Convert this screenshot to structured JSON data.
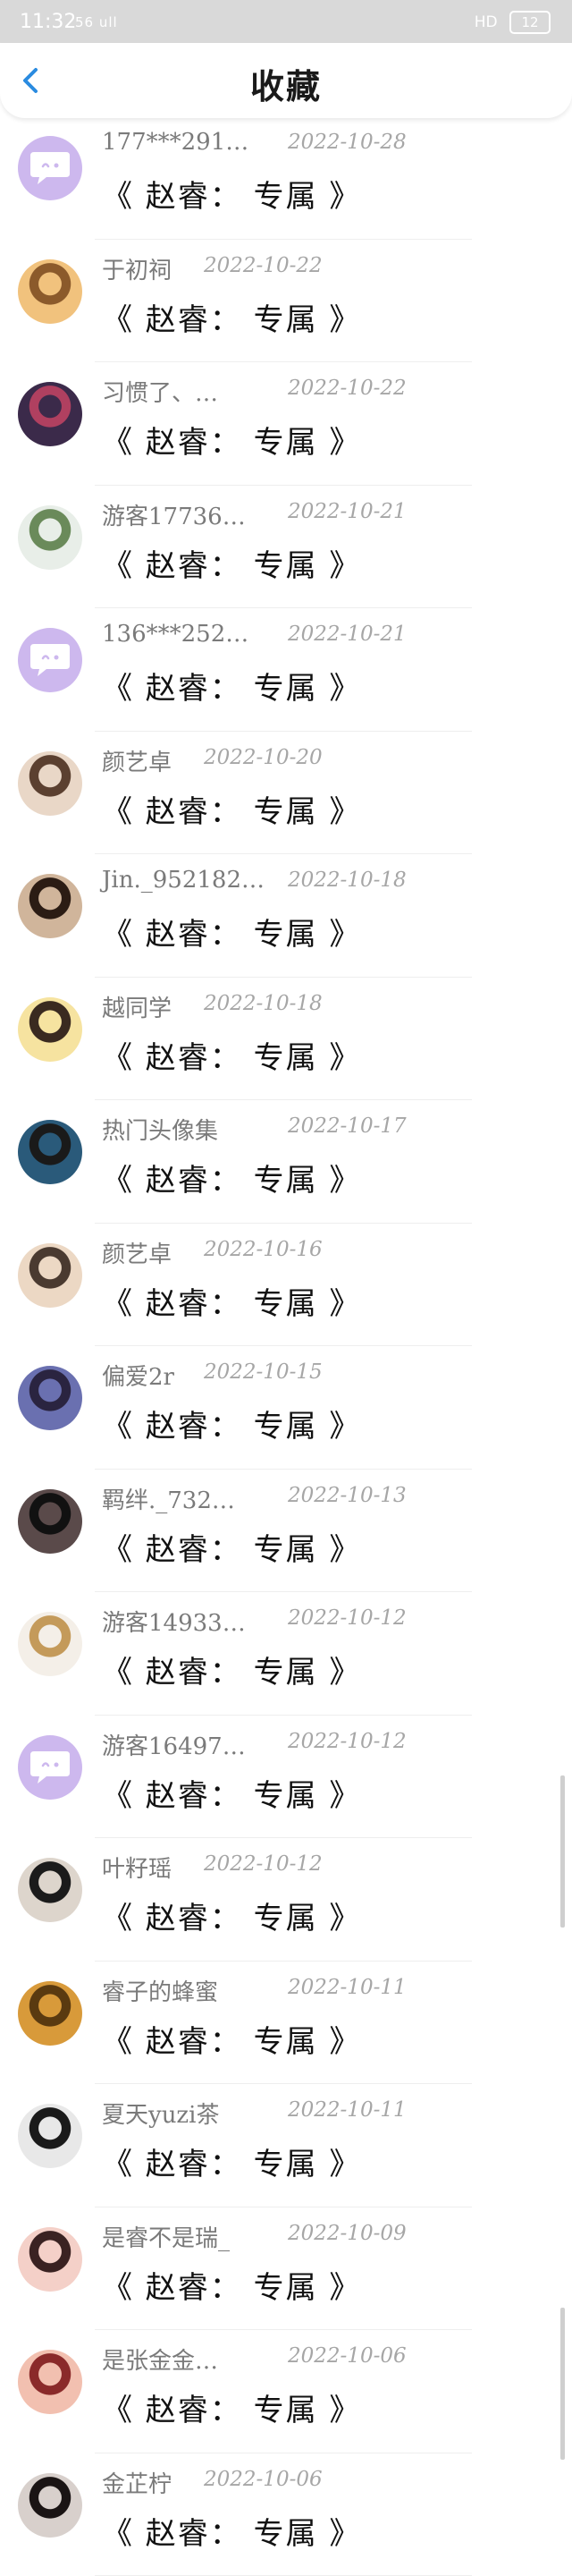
{
  "status": {
    "time": "11:32",
    "signal": "56 ull",
    "network": "HD",
    "battery": "12"
  },
  "header": {
    "title": "收藏"
  },
  "items": [
    {
      "name": "177***291…",
      "date": "2022-10-28",
      "subtitle": "《 赵睿： 专属 》",
      "avatar": "chat-avatar-icon"
    },
    {
      "name": "于初祠",
      "date": "2022-10-22",
      "subtitle": "《 赵睿： 专属 》",
      "avatar": "photo-avatar"
    },
    {
      "name": "习惯了、…",
      "date": "2022-10-22",
      "subtitle": "《 赵睿： 专属 》",
      "avatar": "photo-avatar"
    },
    {
      "name": "游客17736…",
      "date": "2022-10-21",
      "subtitle": "《 赵睿： 专属 》",
      "avatar": "photo-avatar"
    },
    {
      "name": "136***252…",
      "date": "2022-10-21",
      "subtitle": "《 赵睿： 专属 》",
      "avatar": "chat-avatar-icon"
    },
    {
      "name": "颜艺卓",
      "date": "2022-10-20",
      "subtitle": "《 赵睿： 专属 》",
      "avatar": "photo-avatar"
    },
    {
      "name": "Jin._952182…",
      "date": "2022-10-18",
      "subtitle": "《 赵睿： 专属 》",
      "avatar": "photo-avatar"
    },
    {
      "name": "越同学",
      "date": "2022-10-18",
      "subtitle": "《 赵睿： 专属 》",
      "avatar": "photo-avatar"
    },
    {
      "name": "热门头像集",
      "date": "2022-10-17",
      "subtitle": "《 赵睿： 专属 》",
      "avatar": "photo-avatar"
    },
    {
      "name": "颜艺卓",
      "date": "2022-10-16",
      "subtitle": "《 赵睿： 专属 》",
      "avatar": "photo-avatar"
    },
    {
      "name": "偏爱2r",
      "date": "2022-10-15",
      "subtitle": "《 赵睿： 专属 》",
      "avatar": "photo-avatar"
    },
    {
      "name": "羁绊._732…",
      "date": "2022-10-13",
      "subtitle": "《 赵睿： 专属 》",
      "avatar": "photo-avatar"
    },
    {
      "name": "游客14933…",
      "date": "2022-10-12",
      "subtitle": "《 赵睿： 专属 》",
      "avatar": "photo-avatar"
    },
    {
      "name": "游客16497…",
      "date": "2022-10-12",
      "subtitle": "《 赵睿： 专属 》",
      "avatar": "chat-avatar-icon"
    },
    {
      "name": "叶籽瑶",
      "date": "2022-10-12",
      "subtitle": "《 赵睿： 专属 》",
      "avatar": "photo-avatar"
    },
    {
      "name": "睿子的蜂蜜",
      "date": "2022-10-11",
      "subtitle": "《 赵睿： 专属 》",
      "avatar": "photo-avatar"
    },
    {
      "name": "夏天yuzi茶",
      "date": "2022-10-11",
      "subtitle": "《 赵睿： 专属 》",
      "avatar": "photo-avatar"
    },
    {
      "name": "是睿不是瑞_",
      "date": "2022-10-09",
      "subtitle": "《 赵睿： 专属 》",
      "avatar": "photo-avatar"
    },
    {
      "name": "是张金金…",
      "date": "2022-10-06",
      "subtitle": "《 赵睿： 专属 》",
      "avatar": "photo-avatar"
    },
    {
      "name": "金芷柠",
      "date": "2022-10-06",
      "subtitle": "《 赵睿： 专属 》",
      "avatar": "photo-avatar"
    }
  ],
  "colors": {
    "accent": "#2a8be0",
    "chat_avatar_bg": "#cdb8ee",
    "name_text": "#7a7a7a",
    "date_text": "#a6a6a6",
    "subtitle_text": "#111111"
  }
}
